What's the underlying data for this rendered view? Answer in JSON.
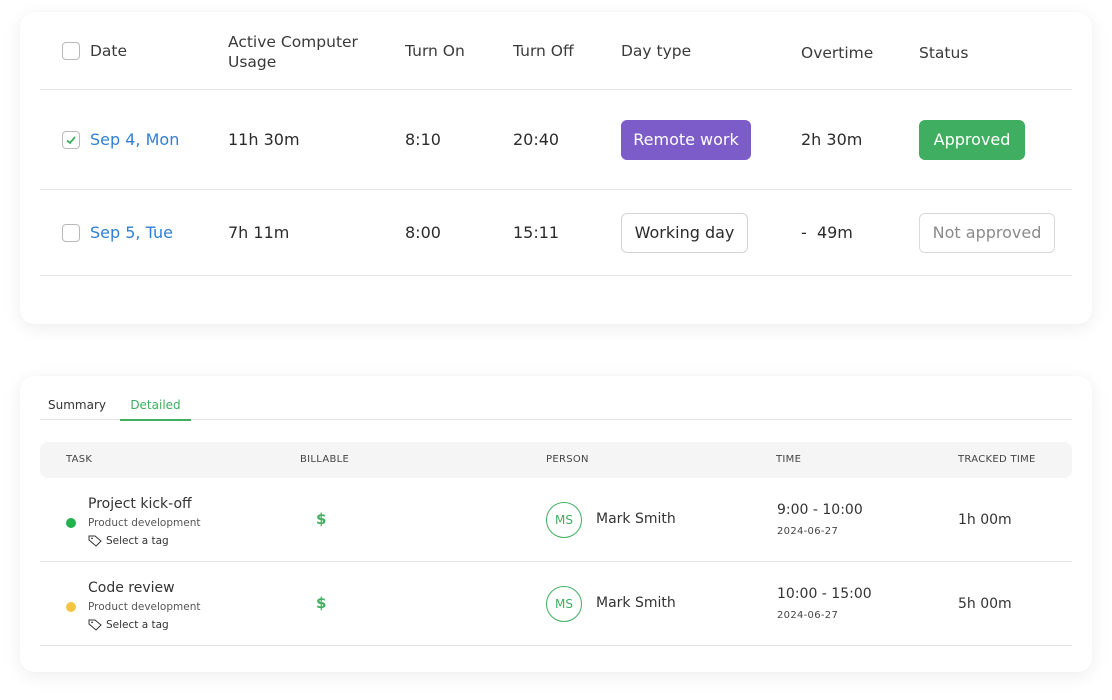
{
  "colors": {
    "link_blue": "#2f7fd6",
    "remote_purple": "#7c5cc9",
    "approved_green": "#3fae60",
    "dot_green": "#22b14c",
    "dot_yellow": "#f4c542"
  },
  "attendance": {
    "headers": {
      "date": "Date",
      "usage": "Active Computer Usage",
      "turn_on": "Turn On",
      "turn_off": "Turn Off",
      "day_type": "Day type",
      "overtime": "Overtime",
      "status": "Status"
    },
    "rows": [
      {
        "checked": true,
        "date": "Sep 4, Mon",
        "usage": "11h 30m",
        "turn_on": "8:10",
        "turn_off": "20:40",
        "day_type": "Remote work",
        "overtime": "2h 30m",
        "status": "Approved"
      },
      {
        "checked": false,
        "date": "Sep 5, Tue",
        "usage": "7h 11m",
        "turn_on": "8:00",
        "turn_off": "15:11",
        "day_type": "Working day",
        "overtime": "-  49m",
        "status": "Not approved"
      }
    ]
  },
  "tasks": {
    "tabs": [
      {
        "label": "Summary",
        "active": false
      },
      {
        "label": "Detailed",
        "active": true
      }
    ],
    "headers": {
      "task": "TASK",
      "billable": "BILLABLE",
      "person": "PERSON",
      "time": "TIME",
      "tracked": "TRACKED TIME"
    },
    "rows": [
      {
        "name": "Project kick-off",
        "project": "Product development",
        "tag": "Select a tag",
        "status_color": "#22b14c",
        "billable": "$",
        "avatar": "MS",
        "person": "Mark Smith",
        "time": "9:00 - 10:00",
        "date": "2024-06-27",
        "tracked": "1h 00m"
      },
      {
        "name": "Code review",
        "project": "Product development",
        "tag": "Select a tag",
        "status_color": "#f4c542",
        "billable": "$",
        "avatar": "MS",
        "person": "Mark Smith",
        "time": "10:00 - 15:00",
        "date": "2024-06-27",
        "tracked": "5h 00m"
      }
    ]
  }
}
